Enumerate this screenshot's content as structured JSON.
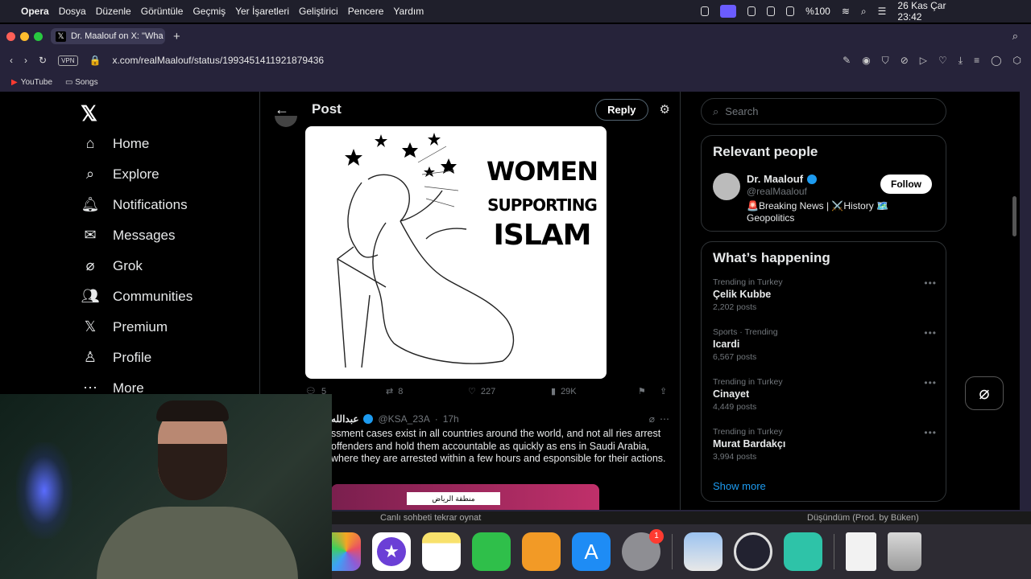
{
  "menubar": {
    "app": "Opera",
    "items": [
      "Dosya",
      "Düzenle",
      "Görüntüle",
      "Geçmiş",
      "Yer İşaretleri",
      "Geliştirici",
      "Pencere",
      "Yardım"
    ],
    "battery": "%100",
    "datetime": "26 Kas Çar  23:42"
  },
  "browser": {
    "tab_title": "Dr. Maalouf  on X: \"Wha",
    "url": "x.com/realMaalouf/status/1993451411921879436",
    "vpn_label": "VPN",
    "bookmarks": [
      "YouTube",
      "Songs"
    ]
  },
  "sidebar": {
    "items": [
      {
        "label": "Home",
        "icon": "home-icon"
      },
      {
        "label": "Explore",
        "icon": "search-icon"
      },
      {
        "label": "Notifications",
        "icon": "bell-icon"
      },
      {
        "label": "Messages",
        "icon": "mail-icon"
      },
      {
        "label": "Grok",
        "icon": "grok-icon"
      },
      {
        "label": "Communities",
        "icon": "people-icon"
      },
      {
        "label": "Premium",
        "icon": "x-icon"
      },
      {
        "label": "Profile",
        "icon": "person-icon"
      },
      {
        "label": "More",
        "icon": "more-icon"
      }
    ]
  },
  "post": {
    "header_title": "Post",
    "reply_button": "Reply",
    "image_text": [
      "WOMEN",
      "SUPPORTING",
      "ISLAM"
    ],
    "stats": {
      "replies": "5",
      "reposts": "8",
      "likes": "227",
      "views": "29K"
    }
  },
  "reply": {
    "name": "عبدالله",
    "handle": "@KSA_23A",
    "time": "17h",
    "text": "ssment cases exist in all countries around the world, and not all ries arrest offenders and hold them accountable as quickly as ens in Saudi Arabia, where they are arrested within a few hours and esponsible for their actions.",
    "video_label": "منطقة الرياض"
  },
  "right": {
    "search_placeholder": "Search",
    "relevant_title": "Relevant people",
    "person": {
      "name": "Dr. Maalouf",
      "handle": "@realMaalouf",
      "bio": "🚨Breaking News | ⚔️History 🗺️ Geopolitics",
      "follow_label": "Follow"
    },
    "happening_title": "What’s happening",
    "trends": [
      {
        "context": "Trending in Turkey",
        "topic": "Çelik Kubbe",
        "count": "2,202 posts"
      },
      {
        "context": "Sports · Trending",
        "topic": "Icardi",
        "count": "6,567 posts"
      },
      {
        "context": "Trending in Turkey",
        "topic": "Cinayet",
        "count": "4,449 posts"
      },
      {
        "context": "Trending in Turkey",
        "topic": "Murat Bardakçı",
        "count": "3,994 posts"
      }
    ],
    "show_more": "Show more"
  },
  "bottom_strip": {
    "left_text": "Canlı sohbeti tekrar oynat",
    "right_text": "Düşündüm (Prod. by Büken)"
  },
  "dock": {
    "apps": [
      {
        "name": "photos-app",
        "color": "#f5a623"
      },
      {
        "name": "imovie-app",
        "color": "#6b3fd6"
      },
      {
        "name": "notes-app",
        "color": "#f8e16c"
      },
      {
        "name": "numbers-app",
        "color": "#2fbf4a"
      },
      {
        "name": "pages-app",
        "color": "#f29a26"
      },
      {
        "name": "app-store-app",
        "color": "#1e8cf5"
      },
      {
        "name": "system-settings-app",
        "color": "#8e8e93"
      },
      {
        "name": "preview-app",
        "color": "#6fa0d8"
      },
      {
        "name": "obs-app",
        "color": "#222230"
      },
      {
        "name": "discord-like-app",
        "color": "#2ec3a8"
      },
      {
        "name": "document-file",
        "color": "#e8e8e8"
      },
      {
        "name": "trash-app",
        "color": "#b5b5b5"
      }
    ],
    "settings_badge": "1"
  }
}
